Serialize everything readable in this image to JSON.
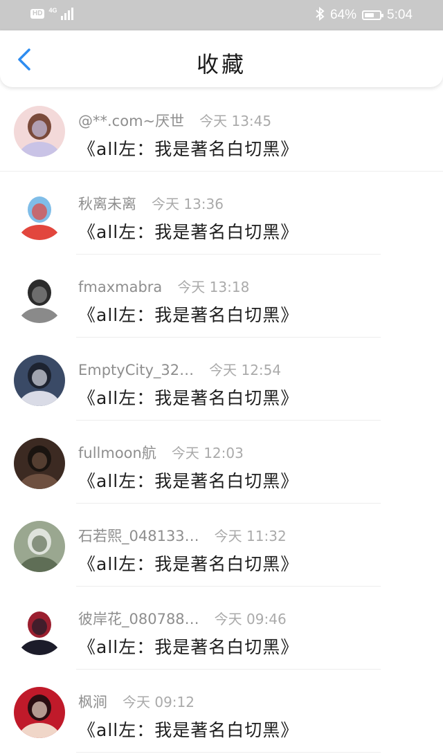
{
  "status_bar": {
    "hd_label": "HD",
    "network_label": "4G",
    "battery_text": "64%",
    "battery_level": 0.64,
    "time": "5:04",
    "bluetooth_icon": "bluetooth-icon",
    "signal_icon": "signal-bars-icon",
    "battery_icon": "battery-icon"
  },
  "nav": {
    "back_icon": "chevron-left-icon",
    "title": "收藏",
    "accent_color": "#2d8cf0"
  },
  "items": [
    {
      "user": "@**.com~厌世",
      "time": "今天 13:45",
      "text": "《all左：我是著名白切黑》",
      "avatar_colors": [
        "#f3d9d9",
        "#7a4a3a",
        "#c9c3e6"
      ]
    },
    {
      "user": "秋离未离",
      "time": "今天 13:36",
      "text": "《all左：我是著名白切黑》",
      "avatar_colors": [
        "#ffffff",
        "#7fbde8",
        "#e2463d"
      ]
    },
    {
      "user": "fmaxmabra",
      "time": "今天 13:18",
      "text": "《all左：我是著名白切黑》",
      "avatar_colors": [
        "#ffffff",
        "#2b2b2b",
        "#8a8a8a"
      ]
    },
    {
      "user": "EmptyCity_32…",
      "time": "今天 12:54",
      "text": "《all左：我是著名白切黑》",
      "avatar_colors": [
        "#3a4a66",
        "#1d2330",
        "#d9dbe6"
      ]
    },
    {
      "user": "fullmoon航",
      "time": "今天 12:03",
      "text": "《all左：我是著名白切黑》",
      "avatar_colors": [
        "#3c2a22",
        "#1a1410",
        "#6e5040"
      ]
    },
    {
      "user": "石若熙_048133…",
      "time": "今天 11:32",
      "text": "《all左：我是著名白切黑》",
      "avatar_colors": [
        "#9aa790",
        "#dfe3dc",
        "#5f6e56"
      ]
    },
    {
      "user": "彼岸花_080788…",
      "time": "今天 09:46",
      "text": "《all左：我是著名白切黑》",
      "avatar_colors": [
        "#ffffff",
        "#9b1f2f",
        "#1c1c2a"
      ]
    },
    {
      "user": "枫涧",
      "time": "今天 09:12",
      "text": "《all左：我是著名白切黑》",
      "avatar_colors": [
        "#c01a2a",
        "#2a0e12",
        "#f0d6c8"
      ]
    }
  ]
}
